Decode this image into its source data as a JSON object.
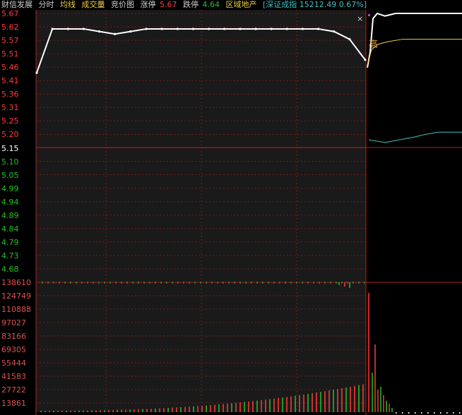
{
  "header": {
    "stock_name": "财信发展",
    "menu_fenshi": "分时",
    "menu_junxian": "均线",
    "menu_volume": "成交量",
    "menu_jingjia": "竞价图",
    "limit_up_label": "涨停",
    "limit_up_value": "5.67",
    "limit_down_label": "跌停",
    "limit_down_value": "4.64",
    "sector": "区域地产",
    "index_info": "[深证成指 15212.49 0.67%]"
  },
  "colors": {
    "up": "#ff3b3b",
    "down": "#22c222",
    "neutral": "#ffffff",
    "avg_line": "#f0d040",
    "index_line": "#40c0c0",
    "grid": "#7a1a1a",
    "name_color": "#cccccc",
    "yellow": "#f0d040"
  },
  "price_axis": {
    "labels_up": [
      "5.67",
      "5.62",
      "5.57",
      "5.51",
      "5.46",
      "5.41",
      "5.36",
      "5.31",
      "5.25",
      "5.20"
    ],
    "label_mid": "5.15",
    "labels_down": [
      "5.10",
      "5.05",
      "4.99",
      "4.94",
      "4.89",
      "4.84",
      "4.79",
      "4.73",
      "4.68"
    ]
  },
  "volume_axis": {
    "labels": [
      "138610",
      "124749",
      "110888",
      "97027",
      "83166",
      "69305",
      "55444",
      "41583",
      "27722",
      "13861"
    ]
  },
  "widgets": {
    "close_symbol": "×",
    "high_tag": "高"
  },
  "chart_data": {
    "type": "line",
    "price_range": [
      4.64,
      5.67
    ],
    "pre_close": 5.15,
    "volume_range": [
      0,
      138610
    ],
    "auction_price_trace": [
      5.44,
      5.61,
      5.61,
      5.61,
      5.6,
      5.59,
      5.6,
      5.61,
      5.61,
      5.61,
      5.61,
      5.61,
      5.61,
      5.61,
      5.61,
      5.61,
      5.61,
      5.61,
      5.61,
      5.6,
      5.57,
      5.49
    ],
    "session_price_trace": [
      5.46,
      5.52,
      5.65,
      5.67,
      5.66,
      5.67,
      5.67,
      5.67,
      5.67,
      5.67
    ],
    "avg_price_trace": [
      5.47,
      5.53,
      5.55,
      5.56,
      5.57,
      5.57,
      5.57
    ],
    "index_trace": [
      5.18,
      5.17,
      5.18,
      5.19,
      5.2,
      5.21,
      5.21,
      5.21
    ]
  }
}
